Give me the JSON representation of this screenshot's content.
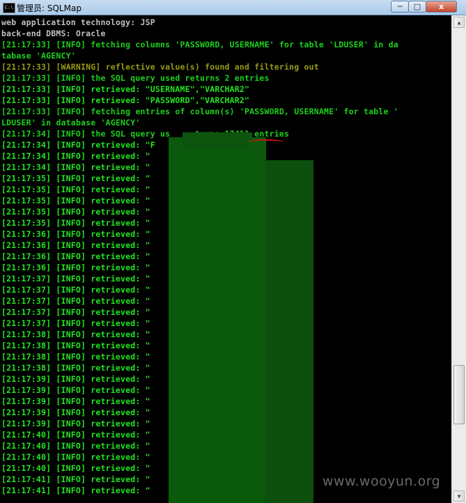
{
  "window": {
    "title": "管理员: SQLMap",
    "icon_label": "C:\\",
    "buttons": {
      "minimize": "─",
      "maximize": "□",
      "close": "x"
    }
  },
  "console": {
    "lines": [
      {
        "text": "web application technology: JSP",
        "color": "white"
      },
      {
        "text": "back-end DBMS: Oracle",
        "color": "white"
      },
      {
        "text": "[21:17:33] [INFO] fetching columns 'PASSWORD, USERNAME' for table 'LDUSER' in da",
        "color": "green"
      },
      {
        "text": "tabase 'AGENCY'",
        "color": "green"
      },
      {
        "text": "[21:17:33] [WARNING] reflective value(s) found and filtering out",
        "color": "olive"
      },
      {
        "text": "[21:17:33] [INFO] the SQL query used returns 2 entries",
        "color": "green"
      },
      {
        "text": "[21:17:33] [INFO] retrieved: \"USERNAME\",\"VARCHAR2\"",
        "color": "bright"
      },
      {
        "text": "[21:17:33] [INFO] retrieved: \"PASSWORD\",\"VARCHAR2\"",
        "color": "bright"
      },
      {
        "text": "[21:17:33] [INFO] fetching entries of column(s) 'PASSWORD, USERNAME' for table '",
        "color": "green"
      },
      {
        "text": "LDUSER' in database 'AGENCY'",
        "color": "green"
      },
      {
        "text": "[21:17:34] [INFO] the SQL query us     turns 17411 entries",
        "color": "green"
      },
      {
        "text": "[21:17:34] [INFO] retrieved: \"F",
        "color": "bright"
      },
      {
        "text": "[21:17:34] [INFO] retrieved: \"",
        "color": "bright"
      },
      {
        "text": "[21:17:34] [INFO] retrieved: \"",
        "color": "bright"
      },
      {
        "text": "[21:17:35] [INFO] retrieved: \"",
        "color": "bright"
      },
      {
        "text": "[21:17:35] [INFO] retrieved: \"",
        "color": "bright"
      },
      {
        "text": "[21:17:35] [INFO] retrieved: \"",
        "color": "bright"
      },
      {
        "text": "[21:17:35] [INFO] retrieved: \"",
        "color": "bright"
      },
      {
        "text": "[21:17:35] [INFO] retrieved: \"",
        "color": "bright"
      },
      {
        "text": "[21:17:36] [INFO] retrieved: \"",
        "color": "bright"
      },
      {
        "text": "[21:17:36] [INFO] retrieved: \"",
        "color": "bright"
      },
      {
        "text": "[21:17:36] [INFO] retrieved: \"",
        "color": "bright"
      },
      {
        "text": "[21:17:36] [INFO] retrieved: \"",
        "color": "bright"
      },
      {
        "text": "[21:17:37] [INFO] retrieved: \"",
        "color": "bright"
      },
      {
        "text": "[21:17:37] [INFO] retrieved: \"",
        "color": "bright"
      },
      {
        "text": "[21:17:37] [INFO] retrieved: \"",
        "color": "bright"
      },
      {
        "text": "[21:17:37] [INFO] retrieved: \"",
        "color": "bright"
      },
      {
        "text": "[21:17:37] [INFO] retrieved: \"",
        "color": "bright"
      },
      {
        "text": "[21:17:38] [INFO] retrieved: \"",
        "color": "bright"
      },
      {
        "text": "[21:17:38] [INFO] retrieved: \"",
        "color": "bright"
      },
      {
        "text": "[21:17:38] [INFO] retrieved: \"",
        "color": "bright"
      },
      {
        "text": "[21:17:38] [INFO] retrieved: \"",
        "color": "bright"
      },
      {
        "text": "[21:17:39] [INFO] retrieved: \"",
        "color": "bright"
      },
      {
        "text": "[21:17:39] [INFO] retrieved: \"",
        "color": "bright"
      },
      {
        "text": "[21:17:39] [INFO] retrieved: \"",
        "color": "bright"
      },
      {
        "text": "[21:17:39] [INFO] retrieved: \"",
        "color": "bright"
      },
      {
        "text": "[21:17:39] [INFO] retrieved: \"",
        "color": "bright"
      },
      {
        "text": "[21:17:40] [INFO] retrieved: \"",
        "color": "bright"
      },
      {
        "text": "[21:17:40] [INFO] retrieved: \"",
        "color": "bright"
      },
      {
        "text": "[21:17:40] [INFO] retrieved: \"",
        "color": "bright"
      },
      {
        "text": "[21:17:40] [INFO] retrieved: \"",
        "color": "bright"
      },
      {
        "text": "[21:17:41] [INFO] retrieved: \"",
        "color": "bright"
      },
      {
        "text": "[21:17:41] [INFO] retrieved: \"",
        "color": "bright"
      }
    ]
  },
  "colors": {
    "white": "#c0c0c0",
    "green": "#1cd11c",
    "olive": "#9a9a18",
    "bright": "#22e522",
    "redaction": "#0b5a0c",
    "annotation": "#cc1111"
  },
  "scrollbar": {
    "up_arrow": "▲",
    "down_arrow": "▼"
  },
  "watermark": "www.wooyun.org"
}
